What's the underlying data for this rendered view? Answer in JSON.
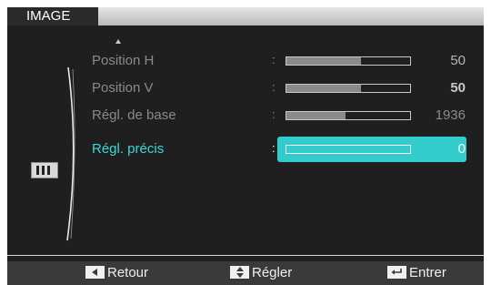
{
  "menu": {
    "title": "IMAGE"
  },
  "items": [
    {
      "label": "Position H",
      "value": "50",
      "level": 0.6
    },
    {
      "label": "Position V",
      "value": "50",
      "level": 0.6
    },
    {
      "label": "Régl. de base",
      "value": "1936",
      "level": 0.48
    },
    {
      "label": "Régl. précis",
      "value": "0",
      "level": 0.0
    }
  ],
  "separator": ":",
  "footer": {
    "back_label": "Retour",
    "adjust_label": "Régler",
    "enter_label": "Entrer"
  },
  "icons": {
    "category": "image-category-icon",
    "scroll": "scroll-up-arrow-icon",
    "back": "left-arrow-key-icon",
    "adjust": "up-down-arrow-key-icon",
    "enter": "enter-key-icon"
  },
  "colors": {
    "background": "#1f1f1f",
    "highlight": "#33cccc",
    "selected_text": "#3fd7d7",
    "inactive_text": "#8a8a8a"
  }
}
